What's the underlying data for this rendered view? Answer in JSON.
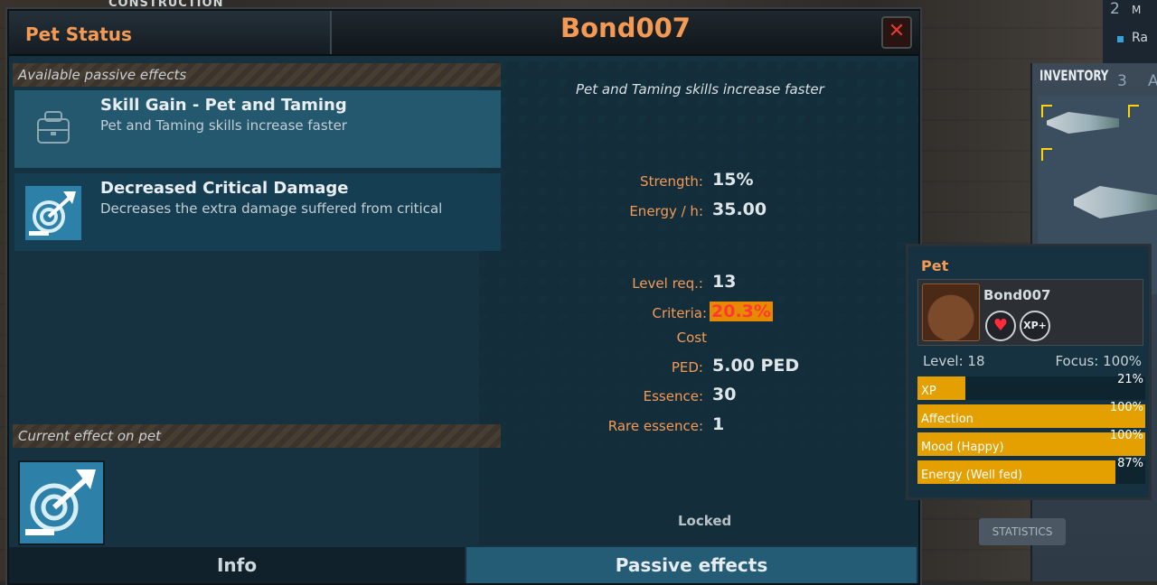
{
  "background": {
    "top_tag": "CONSTRUCTION",
    "corner_number": "2",
    "corner_letter": "M",
    "corner_ra": "Ra",
    "inventory_title": "INVENTORY",
    "inventory_tab_3": "3",
    "inventory_tab_a": "A",
    "statistics_button": "STATISTICS"
  },
  "dialog": {
    "title": "Pet Status",
    "pet_name": "Bond007",
    "close_label": "✕",
    "available_label": "Available passive effects",
    "current_label": "Current effect on pet",
    "effects": [
      {
        "title": "Skill Gain - Pet and Taming",
        "desc": "Pet and Taming skills increase faster"
      },
      {
        "title": "Decreased Critical Damage",
        "desc": "Decreases the extra damage suffered from critical"
      }
    ],
    "detail": {
      "description": "Pet and Taming skills increase faster",
      "strength_label": "Strength:",
      "strength_value": "15%",
      "energy_label": "Energy / h:",
      "energy_value": "35.00",
      "level_label": "Level req.:",
      "level_value": "13",
      "criteria_label": "Criteria:",
      "criteria_value": "20.3%",
      "cost_label": "Cost",
      "ped_label": "PED:",
      "ped_value": "5.00 PED",
      "essence_label": "Essence:",
      "essence_value": "30",
      "rare_label": "Rare essence:",
      "rare_value": "1",
      "locked": "Locked"
    },
    "tabs": {
      "info": "Info",
      "passive": "Passive effects"
    }
  },
  "pet_window": {
    "title": "Pet",
    "name": "Bond007",
    "heart_icon": "heart-icon",
    "xp_label": "XP+",
    "level": "Level: 18",
    "focus": "Focus: 100%",
    "bars": [
      {
        "label": "XP",
        "percent_text": "21%",
        "value": 21
      },
      {
        "label": "Affection",
        "percent_text": "100%",
        "value": 100
      },
      {
        "label": "Mood (Happy)",
        "percent_text": "100%",
        "value": 100
      },
      {
        "label": "Energy (Well fed)",
        "percent_text": "87%",
        "value": 87
      }
    ]
  },
  "colors": {
    "accent": "#f59a55",
    "bar_fill": "#e3a000",
    "selected_row": "#24586f"
  }
}
